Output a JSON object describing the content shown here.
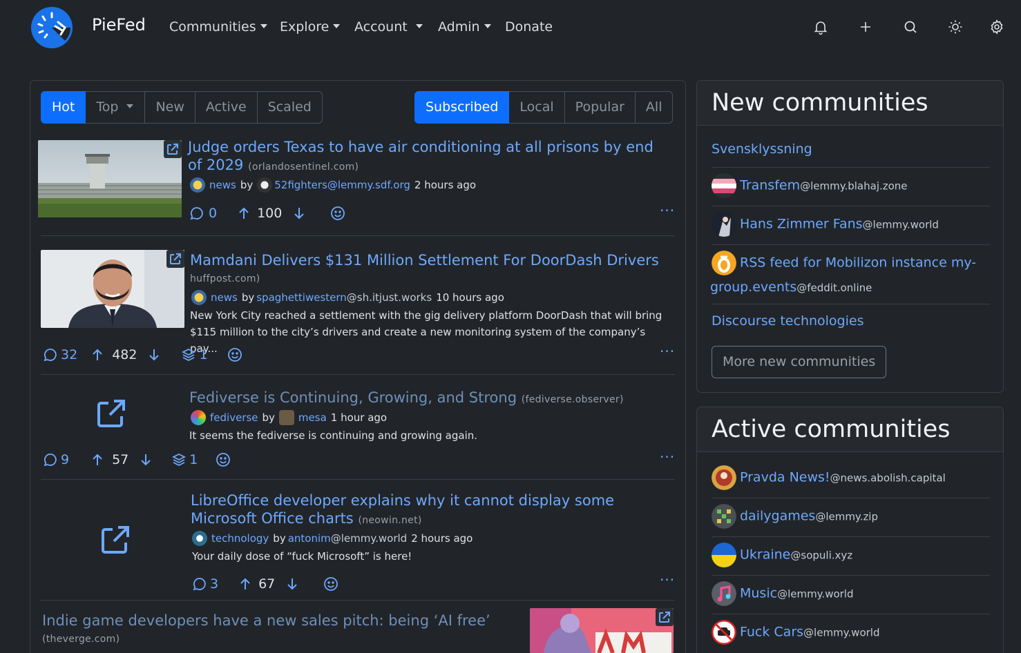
{
  "app": {
    "brand": "PieFed",
    "nav": {
      "communities": "Communities",
      "explore": "Explore",
      "account": "Account",
      "admin": "Admin",
      "donate": "Donate"
    }
  },
  "sort_tabs": [
    "Hot",
    "Top",
    "New",
    "Active",
    "Scaled"
  ],
  "sort_active": "Hot",
  "feed_tabs": [
    "Subscribed",
    "Local",
    "Popular",
    "All"
  ],
  "feed_active": "Subscribed",
  "posts": [
    {
      "title": "Judge orders Texas to have air conditioning at all prisons by end of 2029",
      "domain": "(orlandosentinel.com)",
      "community": "news",
      "by": "by",
      "author": "52fighters",
      "author_instance": "@lemmy.sdf.org",
      "time": "2 hours ago",
      "comments": "0",
      "score": "100"
    },
    {
      "title": "Mamdani Delivers $131 Million Settlement For DoorDash Drivers",
      "domain": "huffpost.com)",
      "community": "news",
      "by": "by",
      "author": "spaghettiwestern",
      "author_instance": "@sh.itjust.works",
      "time": "10 hours ago",
      "body_line1": "New York City reached a settlement with the gig delivery platform DoorDash that will bring",
      "body_line2": "$115 million to the city’s drivers and create a new monitoring system of the company’s pay...",
      "comments": "32",
      "score": "482",
      "crossposts": "1"
    },
    {
      "title": "Fediverse is Continuing, Growing, and Strong",
      "domain": "(fediverse.observer)",
      "community": "fediverse",
      "by": "by",
      "author": "mesa",
      "time": "1 hour ago",
      "body": "It seems the fediverse is continuing and growing again.",
      "comments": "9",
      "score": "57",
      "crossposts": "1"
    },
    {
      "title": "LibreOffice developer explains why it cannot display some Microsoft Office charts",
      "domain": "(neowin.net)",
      "community": "technology",
      "by": "by",
      "author": "antonim",
      "author_instance": "@lemmy.world",
      "time": "2 hours ago",
      "body": "Your daily dose of “fuck Microsoft” is here!",
      "comments": "3",
      "score": "67"
    },
    {
      "title": "Indie game developers have a new sales pitch: being ‘AI free’",
      "domain": "(theverge.com)"
    }
  ],
  "more_label": "···",
  "new_communities": {
    "title": "New communities",
    "items": [
      {
        "name": "Svensklyssning",
        "instance": ""
      },
      {
        "name": "Transfem",
        "instance": "@lemmy.blahaj.zone"
      },
      {
        "name": "Hans Zimmer Fans",
        "instance": "@lemmy.world"
      },
      {
        "name": "RSS feed for Mobilizon instance my-",
        "name2": "group.events",
        "instance": "@feddit.online"
      },
      {
        "name": "Discourse technologies",
        "instance": ""
      }
    ],
    "more_button": "More new communities"
  },
  "active_communities": {
    "title": "Active communities",
    "items": [
      {
        "name": "Pravda News!",
        "instance": "@news.abolish.capital"
      },
      {
        "name": "dailygames",
        "instance": "@lemmy.zip"
      },
      {
        "name": "Ukraine",
        "instance": "@sopuli.xyz"
      },
      {
        "name": "Music",
        "instance": "@lemmy.world"
      },
      {
        "name": "Fuck Cars",
        "instance": "@lemmy.world"
      }
    ]
  },
  "colors": {
    "background": "#212529",
    "accent": "#0d6efd",
    "link": "#6ea8fe"
  }
}
